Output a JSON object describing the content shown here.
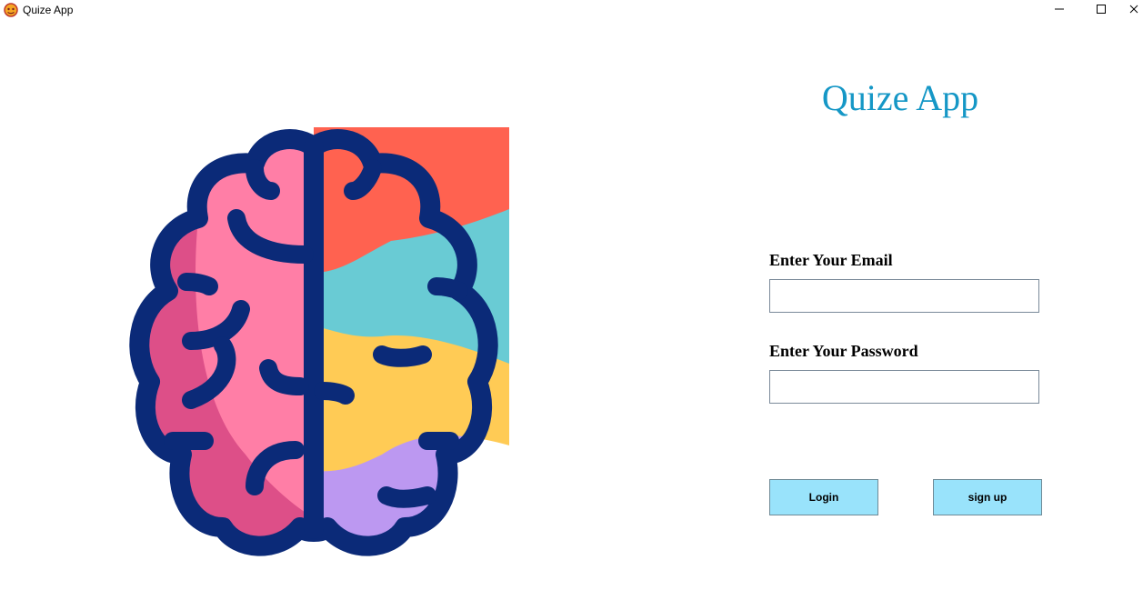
{
  "window": {
    "title": "Quize App",
    "app_icon": "quiz-app-icon",
    "controls": [
      "minimize-icon",
      "maximize-icon",
      "close-icon"
    ]
  },
  "main": {
    "heading": "Quize App",
    "illustration": "brain-icon"
  },
  "form": {
    "email_label": "Enter Your Email",
    "email_value": "",
    "password_label": "Enter Your Password",
    "password_value": "",
    "login_label": "Login",
    "signup_label": "sign up"
  },
  "colors": {
    "heading": "#1597c6",
    "button_bg": "#99e3fb",
    "brain_outline": "#0b2a78",
    "brain_pink": "#ff7ea6",
    "brain_magenta": "#dd4f88",
    "brain_orange": "#ff6250",
    "brain_teal": "#69cbd4",
    "brain_yellow": "#ffcb55",
    "brain_purple": "#bc98f1"
  }
}
